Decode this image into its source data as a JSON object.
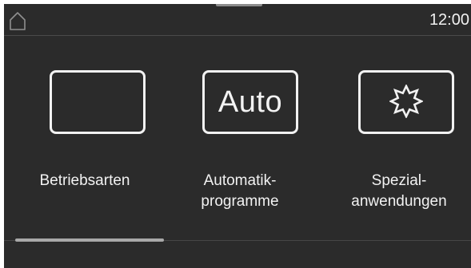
{
  "status_bar": {
    "home_icon": "home-icon",
    "time": "12:00"
  },
  "tiles": [
    {
      "label": "Betriebsarten",
      "icon": "empty-frame-icon"
    },
    {
      "label": "Automatik-\nprogramme",
      "icon_text": "Auto"
    },
    {
      "label": "Spezial-\nanwendungen",
      "icon": "star-burst-icon"
    }
  ],
  "pagination": {
    "current_page": 1,
    "total_pages": 3
  },
  "colors": {
    "background": "#2b2b2b",
    "foreground": "#f2f2f2",
    "divider": "#474747",
    "indicator": "#a9a9a9"
  }
}
